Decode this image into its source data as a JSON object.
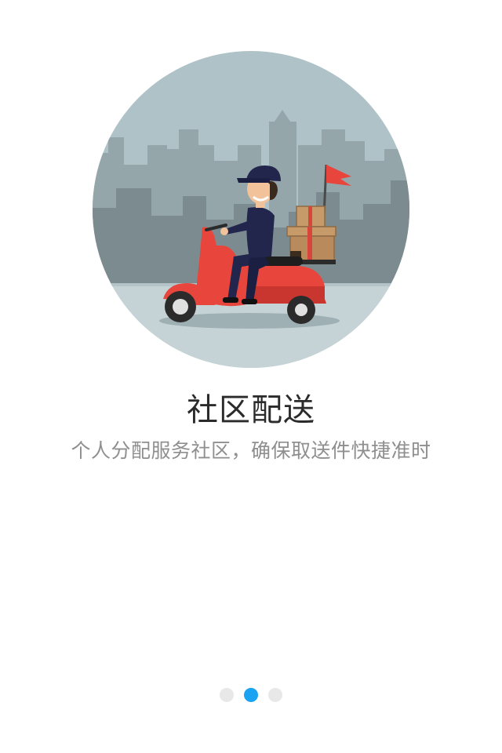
{
  "onboarding": {
    "title": "社区配送",
    "subtitle": "个人分配服务社区，确保取送件快捷准时",
    "illustration": "delivery-scooter-city-illustration",
    "pages_total": 3,
    "active_page": 2
  },
  "colors": {
    "circle_bg": "#aec2c8",
    "city_far": "#95a6ab",
    "city_near": "#7c8b90",
    "road": "#c6d3d6",
    "scooter": "#e8453c",
    "rider_jacket": "#22264d",
    "box": "#b98b5c",
    "flag": "#e8453c",
    "dot_active": "#1aa3f2",
    "dot_inactive": "#e8e8e8"
  }
}
